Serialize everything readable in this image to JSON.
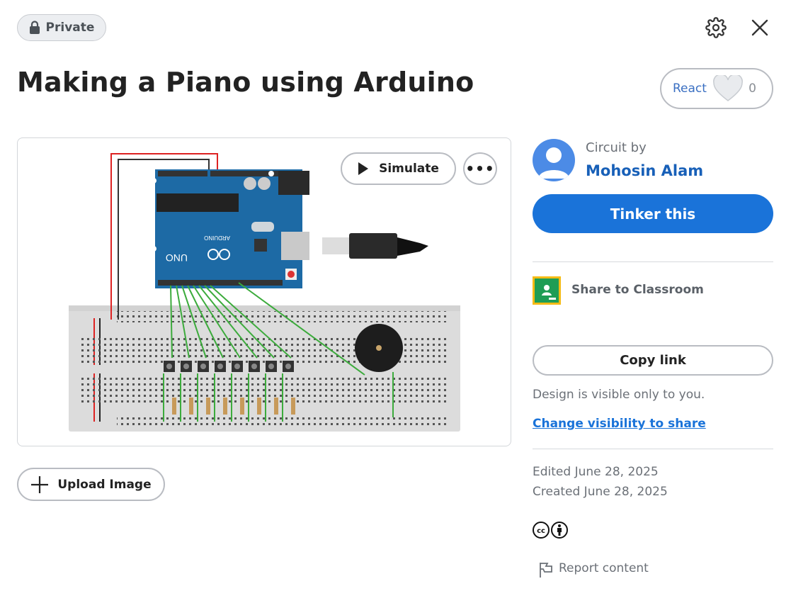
{
  "header": {
    "privacy_badge": "Private",
    "title": "Making a Piano using Arduino",
    "react_label": "React",
    "react_count": "0"
  },
  "canvas": {
    "simulate_label": "Simulate",
    "more_label": "•••",
    "board_brand": "ARDUINO",
    "board_model": "UNO"
  },
  "actions": {
    "upload_image_label": "Upload Image"
  },
  "author": {
    "prefix": "Circuit by",
    "name": "Mohosin Alam"
  },
  "sidebar": {
    "tinker_label": "Tinker this",
    "classroom_label": "Share to Classroom",
    "copy_link_label": "Copy link",
    "visibility_note": "Design is visible only to you.",
    "change_visibility_label": "Change visibility to share",
    "edited": "Edited June 28, 2025",
    "created": "Created June 28, 2025",
    "report_label": "Report content"
  },
  "colors": {
    "accent": "#1a73d9",
    "author_link": "#1860b8",
    "arduino_blue": "#1d6aa5",
    "breadboard": "#dcdcdc",
    "wire_green": "#3cab3c",
    "wire_red": "#d22",
    "classroom_yellow": "#f5bb15",
    "classroom_green": "#1f9d55"
  },
  "icons": {
    "privacy": "lock-icon",
    "settings": "gear-icon",
    "close": "close-icon",
    "react": "heart-icon",
    "simulate": "play-icon",
    "upload": "plus-icon",
    "classroom": "google-classroom-icon",
    "license": "creative-commons-by-icon",
    "report": "flag-icon"
  }
}
